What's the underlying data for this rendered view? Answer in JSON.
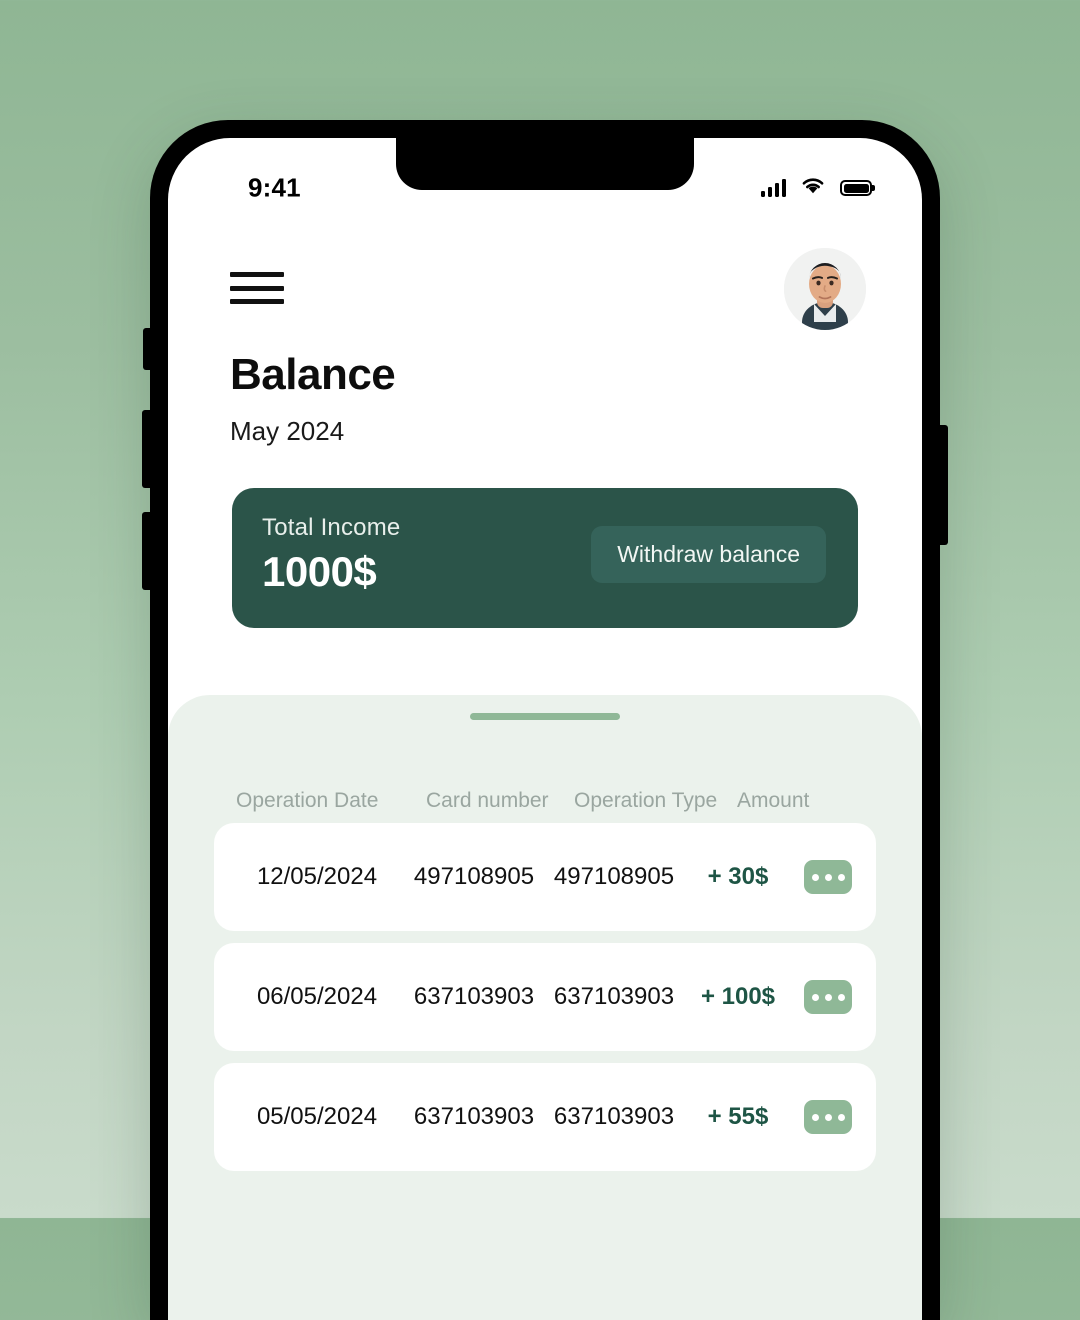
{
  "background": {
    "gradient_top": "#8fb694",
    "gradient_bottom": "#c9dbcb"
  },
  "status_bar": {
    "time": "9:41",
    "cellular_icon": "signal-bars-icon",
    "wifi_icon": "wifi-icon",
    "battery_icon": "battery-icon"
  },
  "header": {
    "menu_icon": "hamburger-menu-icon",
    "avatar_icon": "user-avatar"
  },
  "page": {
    "title": "Balance",
    "subtitle": "May 2024"
  },
  "balance_card": {
    "label": "Total Income",
    "amount": "1000$",
    "withdraw_label": "Withdraw balance",
    "card_color": "#2b5449",
    "button_color": "#35635a"
  },
  "sheet": {
    "handle_color": "#8fb897",
    "background_color": "#ebf2ec",
    "columns": [
      "Operation Date",
      "Card number",
      "Operation Type",
      "Amount"
    ],
    "rows": [
      {
        "date": "12/05/2024",
        "card": "497108905",
        "type": "497108905",
        "amount": "+ 30$",
        "more_icon": "ellipsis-icon"
      },
      {
        "date": "06/05/2024",
        "card": "637103903",
        "type": "637103903",
        "amount": "+ 100$",
        "more_icon": "ellipsis-icon"
      },
      {
        "date": "05/05/2024",
        "card": "637103903",
        "type": "637103903",
        "amount": "+ 55$",
        "more_icon": "ellipsis-icon"
      }
    ],
    "amount_color": "#1e5545",
    "more_button_color": "#8fb897"
  }
}
